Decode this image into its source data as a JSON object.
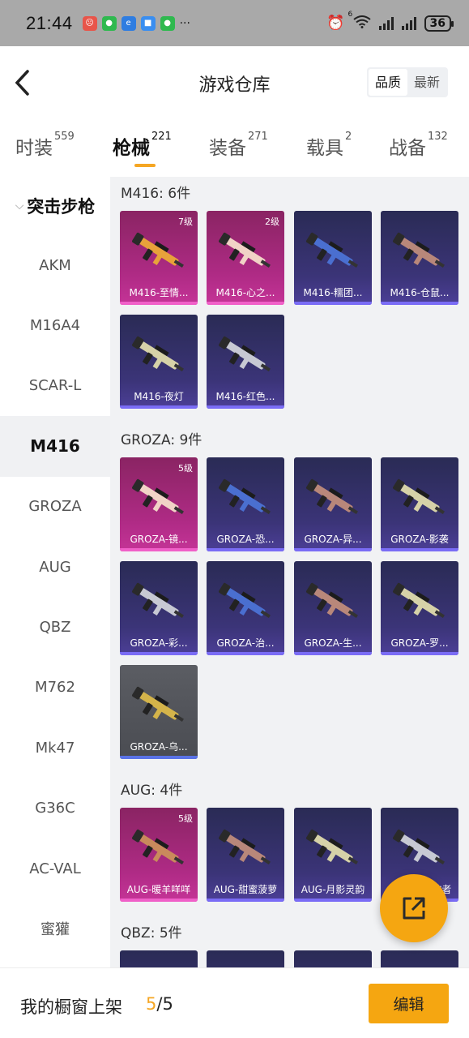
{
  "status_bar": {
    "time": "21:44",
    "battery": "36",
    "wifi_sup": "6",
    "more": "···"
  },
  "header": {
    "title": "游戏仓库",
    "sort_quality": "品质",
    "sort_newest": "最新"
  },
  "tabs": [
    {
      "label": "时装",
      "count": "559"
    },
    {
      "label": "枪械",
      "count": "221"
    },
    {
      "label": "装备",
      "count": "271"
    },
    {
      "label": "载具",
      "count": "2"
    },
    {
      "label": "战备",
      "count": "132"
    }
  ],
  "sidebar": {
    "category": "突击步枪",
    "items": [
      "AKM",
      "M16A4",
      "SCAR-L",
      "M416",
      "GROZA",
      "AUG",
      "QBZ",
      "M762",
      "Mk47",
      "G36C",
      "AC-VAL",
      "蜜獾"
    ]
  },
  "groups": [
    {
      "title": "M416: 6件",
      "items": [
        {
          "name": "M416-至情...",
          "level": "7级",
          "rarity": "pink"
        },
        {
          "name": "M416-心之...",
          "level": "2级",
          "rarity": "pink"
        },
        {
          "name": "M416-糯团...",
          "level": "",
          "rarity": "blue"
        },
        {
          "name": "M416-仓鼠...",
          "level": "",
          "rarity": "blue"
        },
        {
          "name": "M416-夜灯",
          "level": "",
          "rarity": "blue"
        },
        {
          "name": "M416-红色...",
          "level": "",
          "rarity": "blue"
        }
      ]
    },
    {
      "title": "GROZA: 9件",
      "items": [
        {
          "name": "GROZA-镜...",
          "level": "5级",
          "rarity": "pink"
        },
        {
          "name": "GROZA-恐...",
          "level": "",
          "rarity": "blue"
        },
        {
          "name": "GROZA-异...",
          "level": "",
          "rarity": "blue"
        },
        {
          "name": "GROZA-影袭",
          "level": "",
          "rarity": "blue"
        },
        {
          "name": "GROZA-彩...",
          "level": "",
          "rarity": "blue"
        },
        {
          "name": "GROZA-治...",
          "level": "",
          "rarity": "blue"
        },
        {
          "name": "GROZA-生...",
          "level": "",
          "rarity": "blue"
        },
        {
          "name": "GROZA-罗...",
          "level": "",
          "rarity": "blue"
        },
        {
          "name": "GROZA-乌...",
          "level": "",
          "rarity": "gray"
        }
      ]
    },
    {
      "title": "AUG: 4件",
      "items": [
        {
          "name": "AUG-暖羊咩咩",
          "level": "5级",
          "rarity": "pink"
        },
        {
          "name": "AUG-甜蜜菠萝",
          "level": "",
          "rarity": "blue"
        },
        {
          "name": "AUG-月影灵韵",
          "level": "",
          "rarity": "blue"
        },
        {
          "name": "AUG-耀粉歌者",
          "level": "",
          "rarity": "blue"
        }
      ]
    },
    {
      "title": "QBZ: 5件",
      "items": [
        {
          "name": "",
          "level": "",
          "rarity": "blue"
        },
        {
          "name": "",
          "level": "",
          "rarity": "blue"
        },
        {
          "name": "",
          "level": "",
          "rarity": "blue"
        },
        {
          "name": "",
          "level": "",
          "rarity": "blue"
        }
      ]
    }
  ],
  "bottom": {
    "label": "我的橱窗上架",
    "count_current": "5",
    "count_sep": "/",
    "count_total": "5",
    "edit": "编辑"
  },
  "colors": {
    "accent": "#f5a611",
    "pink_card": "#b02b86",
    "blue_card": "#3b3478",
    "gray_card": "#4a4c52"
  }
}
